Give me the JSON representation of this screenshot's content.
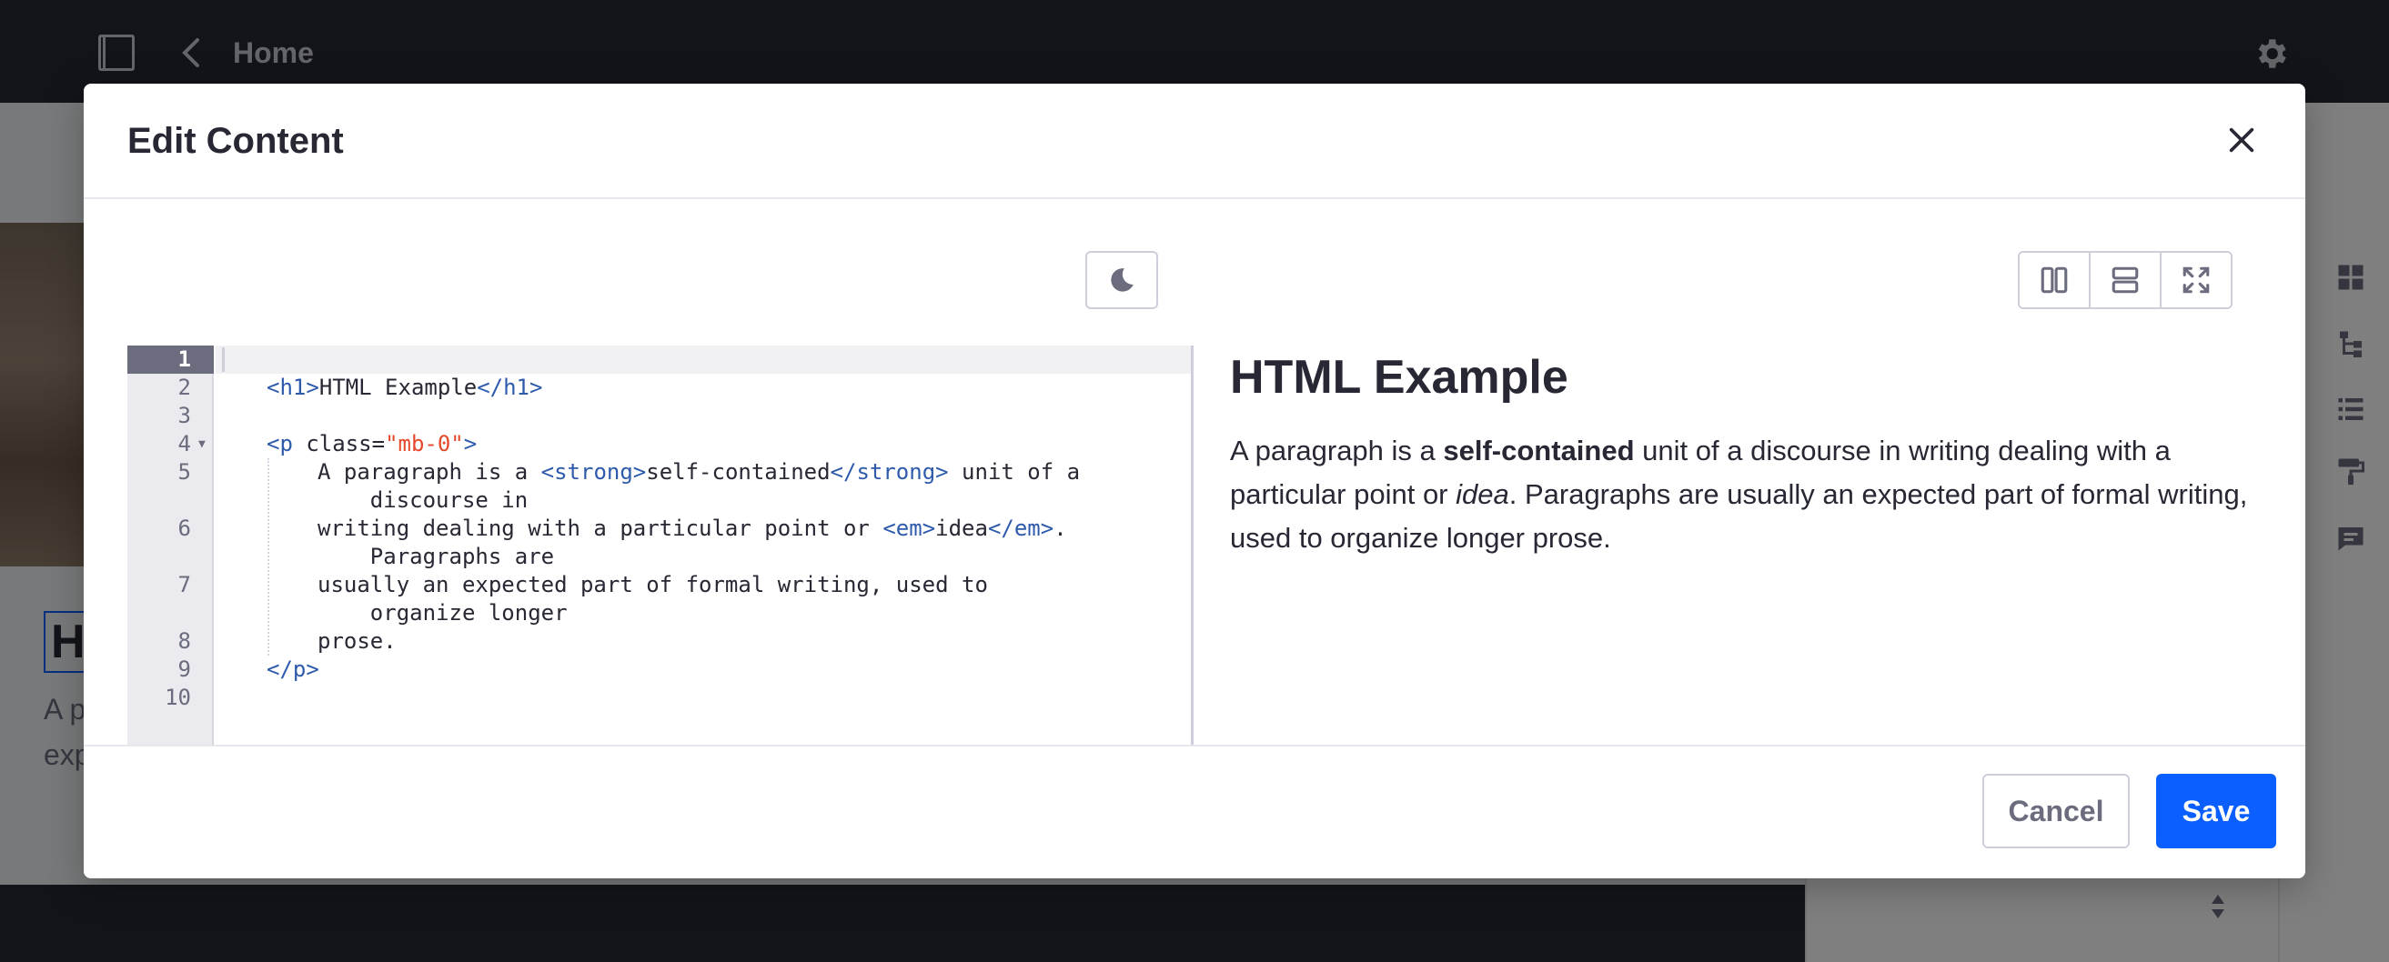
{
  "app": {
    "topbar_title": "Home",
    "background_heading_fragment": "HT",
    "background_paragraph_fragment": "A p exp"
  },
  "modal": {
    "title": "Edit Content",
    "close_icon": "close-icon",
    "theme_icon": "moon-icon",
    "view_icons": [
      "split-vertical-icon",
      "split-horizontal-icon",
      "fullscreen-icon"
    ]
  },
  "editor": {
    "active_line": 1,
    "lines": [
      {
        "num": "1",
        "text": ""
      },
      {
        "num": "2",
        "text": "<h1>HTML Example</h1>"
      },
      {
        "num": "3",
        "text": ""
      },
      {
        "num": "4",
        "text": "<p class=\"mb-0\">"
      },
      {
        "num": "5",
        "text": "A paragraph is a <strong>self-contained</strong> unit of a discourse in"
      },
      {
        "num": "6",
        "text": "writing dealing with a particular point or <em>idea</em>. Paragraphs are"
      },
      {
        "num": "7",
        "text": "usually an expected part of formal writing, used to organize longer"
      },
      {
        "num": "8",
        "text": "prose."
      },
      {
        "num": "9",
        "text": "</p>"
      },
      {
        "num": "10",
        "text": ""
      }
    ]
  },
  "preview": {
    "title": "HTML Example",
    "paragraph": {
      "before_strong": "A paragraph is a ",
      "strong": "self-contained",
      "middle": " unit of a discourse in writing dealing with a particular point or ",
      "em": "idea",
      "after": ". Paragraphs are usually an expected part of formal writing, used to organize longer prose."
    }
  },
  "footer": {
    "cancel_label": "Cancel",
    "save_label": "Save"
  },
  "colors": {
    "primary": "#0b5fff",
    "tag": "#2e5aac",
    "attribute_value": "#e5482d",
    "text": "#272833",
    "secondary": "#6b6c7e"
  }
}
